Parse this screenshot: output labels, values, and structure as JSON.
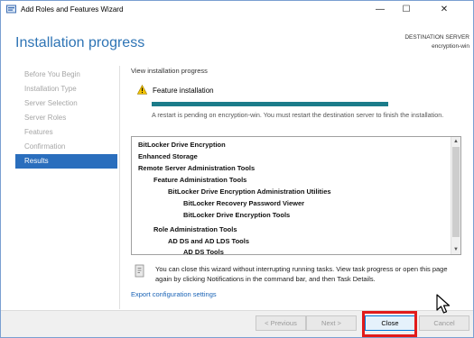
{
  "window": {
    "title": "Add Roles and Features Wizard",
    "minimize_glyph": "—",
    "maximize_glyph": "☐",
    "close_glyph": "✕"
  },
  "header": {
    "page_title": "Installation progress",
    "destination_label": "DESTINATION SERVER",
    "destination_value": "encryption-win"
  },
  "nav": {
    "items": [
      {
        "label": "Before You Begin",
        "active": false
      },
      {
        "label": "Installation Type",
        "active": false
      },
      {
        "label": "Server Selection",
        "active": false
      },
      {
        "label": "Server Roles",
        "active": false
      },
      {
        "label": "Features",
        "active": false
      },
      {
        "label": "Confirmation",
        "active": false
      },
      {
        "label": "Results",
        "active": true
      }
    ]
  },
  "main": {
    "view_progress": "View installation progress",
    "feature_label": "Feature installation",
    "progress_fraction": 1.0,
    "restart_message": "A restart is pending on encryption-win. You must restart the destination server to finish the installation.",
    "results": [
      {
        "text": "BitLocker Drive Encryption",
        "level": 0
      },
      {
        "text": "Enhanced Storage",
        "level": 0
      },
      {
        "text": "Remote Server Administration Tools",
        "level": 0
      },
      {
        "text": "Feature Administration Tools",
        "level": 1
      },
      {
        "text": "BitLocker Drive Encryption Administration Utilities",
        "level": 2
      },
      {
        "text": "BitLocker Recovery Password Viewer",
        "level": 3
      },
      {
        "text": "BitLocker Drive Encryption Tools",
        "level": 3
      },
      {
        "text": "Role Administration Tools",
        "level": 1
      },
      {
        "text": "AD DS and AD LDS Tools",
        "level": 2
      },
      {
        "text": "AD DS Tools",
        "level": 3
      }
    ],
    "info_text": "You can close this wizard without interrupting running tasks. View task progress or open this page again by clicking Notifications in the command bar, and then Task Details.",
    "export_link": "Export configuration settings"
  },
  "footer": {
    "previous": "< Previous",
    "next": "Next >",
    "close": "Close",
    "cancel": "Cancel"
  },
  "colors": {
    "accent": "#2a6ebd",
    "title": "#2e74b5",
    "progress": "#1b7c8a",
    "highlight": "#e11b1b"
  }
}
